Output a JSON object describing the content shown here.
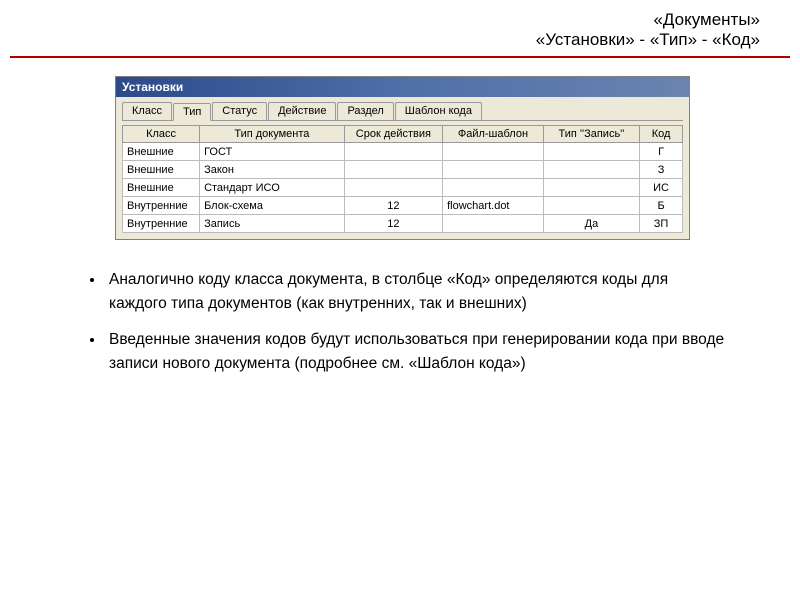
{
  "header": {
    "line1": "«Документы»",
    "line2": "«Установки» - «Тип» - «Код»"
  },
  "window": {
    "title": "Установки",
    "tabs": [
      {
        "label": "Класс"
      },
      {
        "label": "Тип"
      },
      {
        "label": "Статус"
      },
      {
        "label": "Действие"
      },
      {
        "label": "Раздел"
      },
      {
        "label": "Шаблон кода"
      }
    ],
    "columns": {
      "class": "Класс",
      "type": "Тип документа",
      "srok": "Срок действия",
      "file": "Файл-шаблон",
      "tipz": "Тип ''Запись''",
      "code": "Код"
    },
    "rows": [
      {
        "class": "Внешние",
        "type": "ГОСТ",
        "srok": "",
        "file": "",
        "tipz": "",
        "code": "Г"
      },
      {
        "class": "Внешние",
        "type": "Закон",
        "srok": "",
        "file": "",
        "tipz": "",
        "code": "З"
      },
      {
        "class": "Внешние",
        "type": "Стандарт ИСО",
        "srok": "",
        "file": "",
        "tipz": "",
        "code": "ИС"
      },
      {
        "class": "Внутренние",
        "type": "Блок-схема",
        "srok": "12",
        "file": "flowchart.dot",
        "tipz": "",
        "code": "Б"
      },
      {
        "class": "Внутренние",
        "type": "Запись",
        "srok": "12",
        "file": "",
        "tipz": "Да",
        "code": "ЗП"
      }
    ]
  },
  "bullets": {
    "b1": "Аналогично коду класса документа, в столбце «Код» определяются коды для каждого типа документов (как внутренних, так и внешних)",
    "b2": "Введенные значения кодов будут использоваться при генерировании кода при вводе записи нового документа (подробнее см. «Шаблон кода»)"
  }
}
